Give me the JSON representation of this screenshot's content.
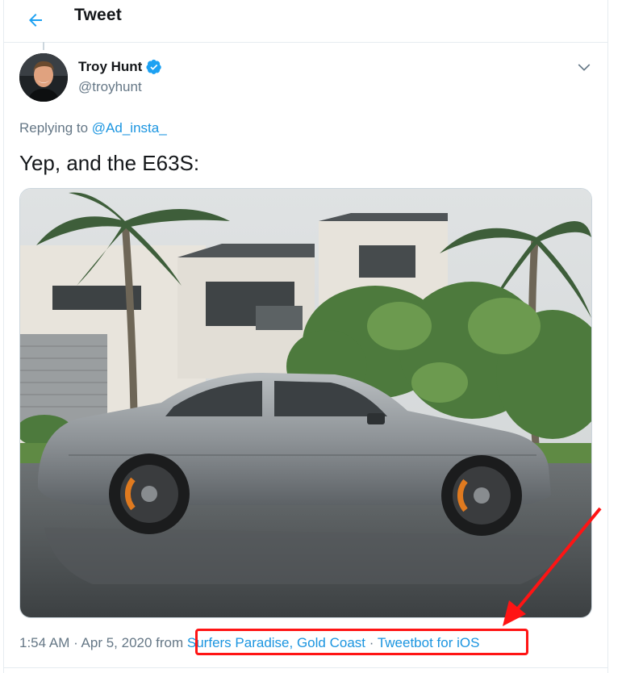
{
  "header": {
    "title": "Tweet",
    "back_icon": "arrow-left-icon"
  },
  "tweet": {
    "author": {
      "display_name": "Troy Hunt",
      "handle": "@troyhunt",
      "verified": true
    },
    "replying_prefix": "Replying to",
    "replying_to": "@Ad_insta_",
    "text": "Yep, and the E63S:",
    "timestamp": "1:54 AM · Apr 5, 2020 from ",
    "location": "Surfers Paradise, Gold Coast",
    "separator": " · ",
    "client": "Tweetbot for iOS"
  },
  "annotation": {
    "color": "#ff1414"
  },
  "colors": {
    "accent": "#1b95e0",
    "verified": "#1da1f2",
    "muted": "#657786"
  }
}
